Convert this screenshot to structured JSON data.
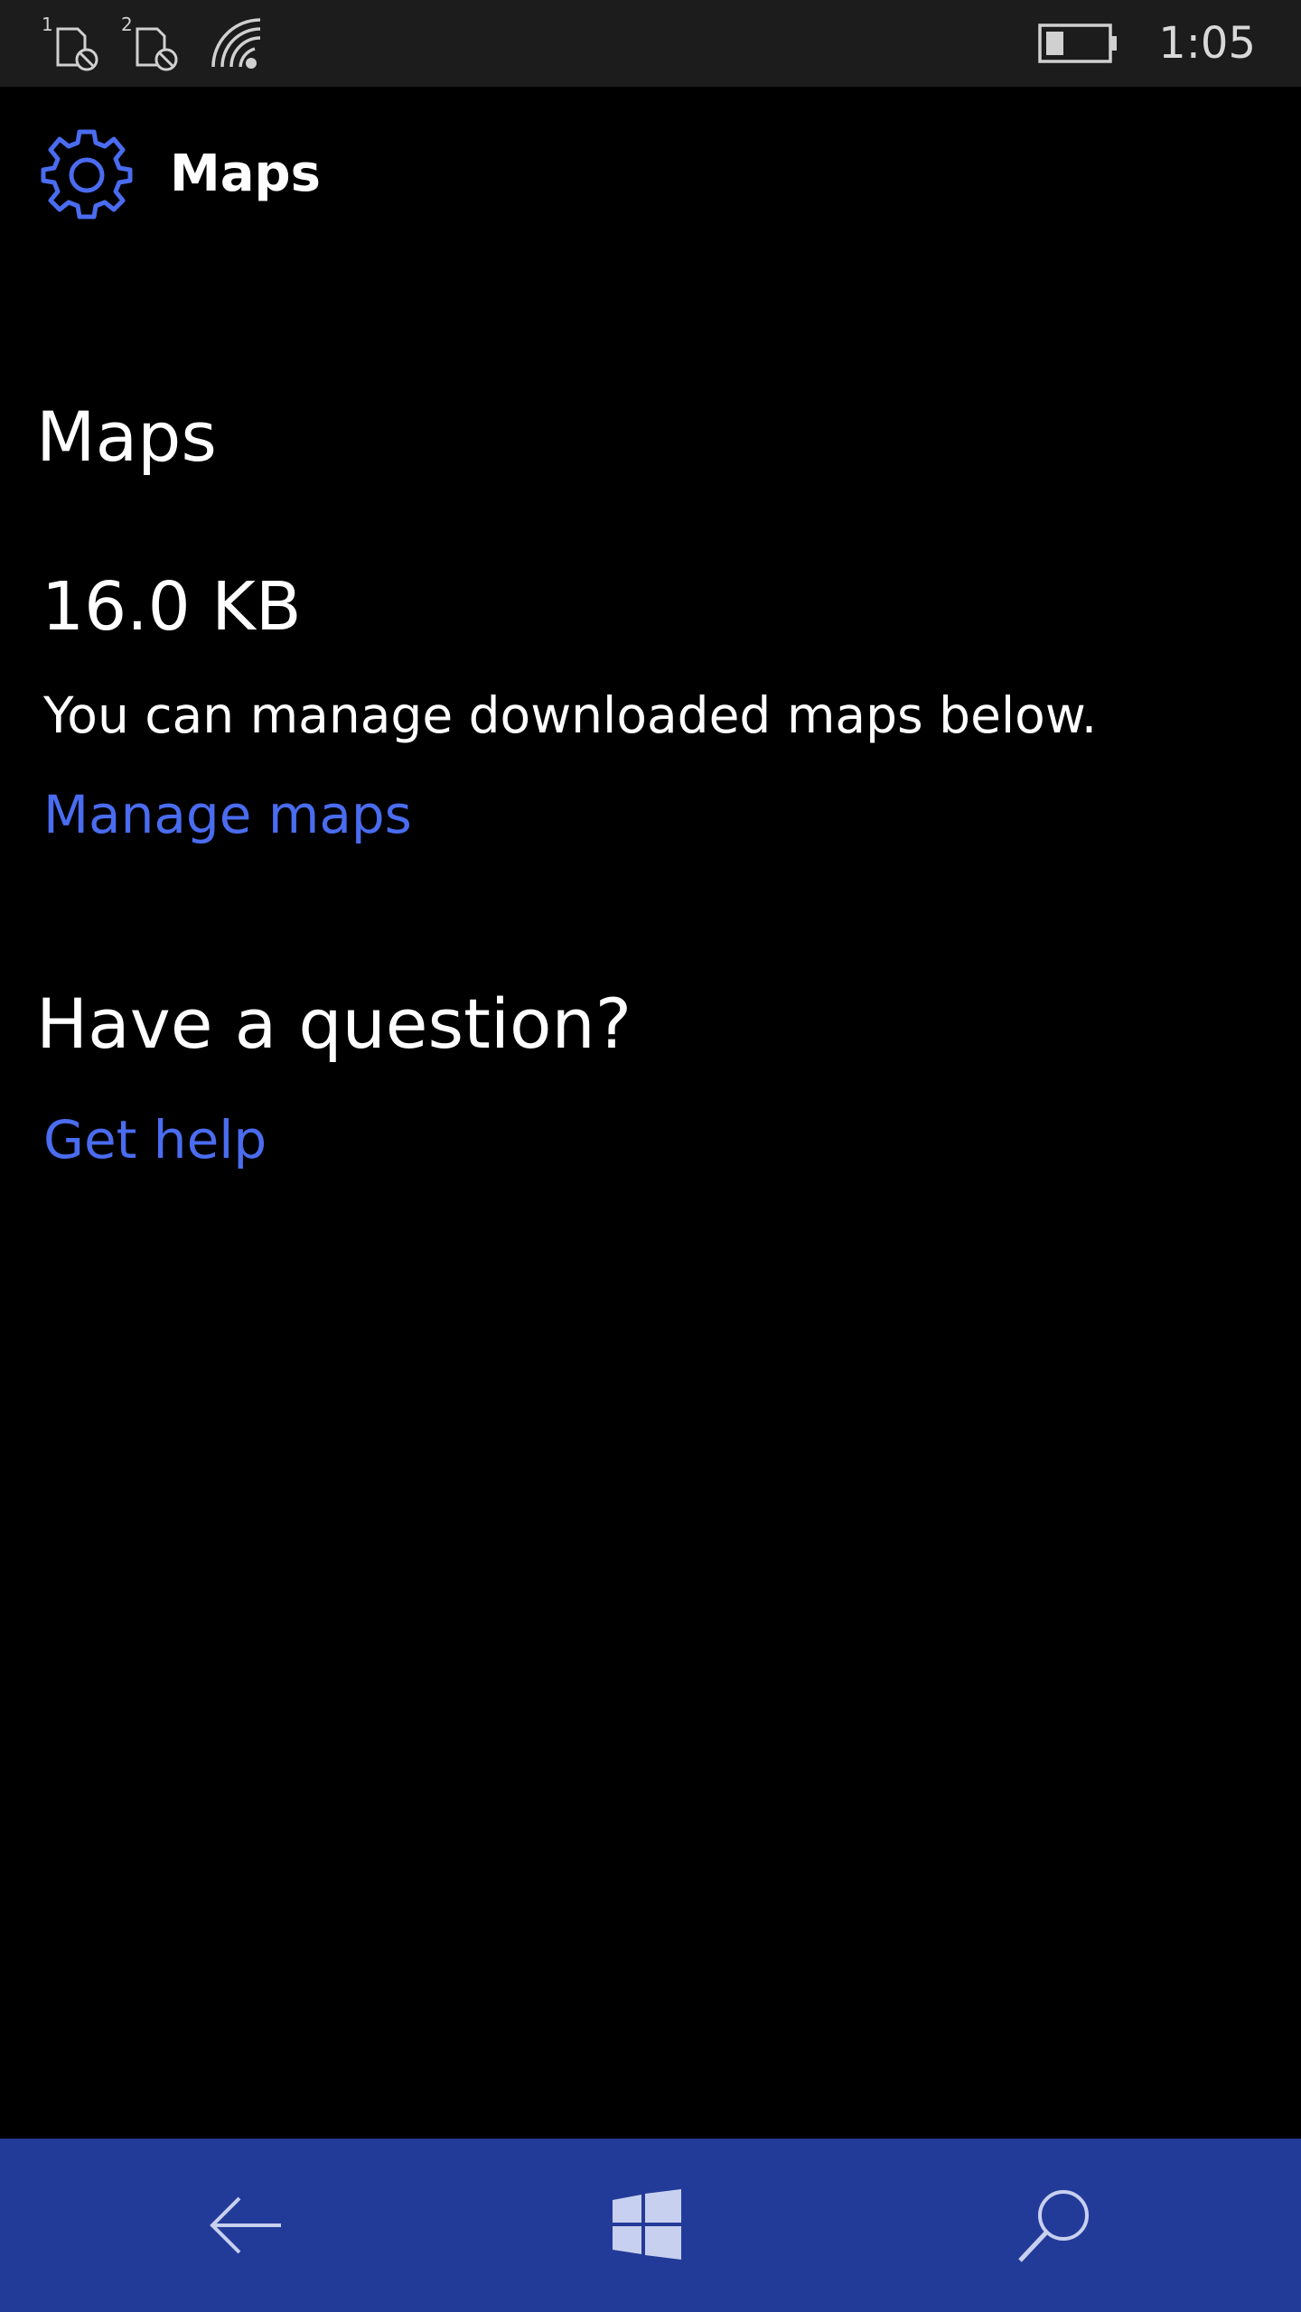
{
  "status_bar": {
    "sim1_label": "1",
    "sim2_label": "2",
    "time": "1:05",
    "battery_level": 0.3,
    "icons": [
      "sim-no-service-icon",
      "sim-no-service-icon",
      "wifi-icon",
      "battery-icon"
    ]
  },
  "header": {
    "title": "Maps",
    "icon": "gear-icon"
  },
  "content": {
    "section_title": "Maps",
    "storage_size": "16.0 KB",
    "description": "You can manage downloaded maps below.",
    "manage_link": "Manage maps",
    "question_title": "Have a question?",
    "help_link": "Get help"
  },
  "nav_bar": {
    "icons": [
      "back-arrow-icon",
      "windows-icon",
      "search-icon"
    ]
  },
  "colors": {
    "accent": "#4a6cf0",
    "nav_bar": "#233b98",
    "status_bar": "#1c1c1c",
    "background": "#000000"
  }
}
